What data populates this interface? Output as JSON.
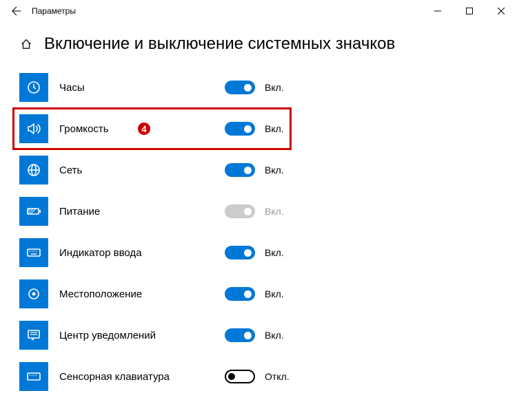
{
  "window": {
    "title": "Параметры"
  },
  "page": {
    "title": "Включение и выключение системных значков"
  },
  "items": [
    {
      "label": "Часы",
      "state": "Вкл.",
      "on": true,
      "disabled": false,
      "icon": "clock"
    },
    {
      "label": "Громкость",
      "state": "Вкл.",
      "on": true,
      "disabled": false,
      "icon": "volume"
    },
    {
      "label": "Сеть",
      "state": "Вкл.",
      "on": true,
      "disabled": false,
      "icon": "globe"
    },
    {
      "label": "Питание",
      "state": "Вкл.",
      "on": true,
      "disabled": true,
      "icon": "battery"
    },
    {
      "label": "Индикатор ввода",
      "state": "Вкл.",
      "on": true,
      "disabled": false,
      "icon": "keyboard"
    },
    {
      "label": "Местоположение",
      "state": "Вкл.",
      "on": true,
      "disabled": false,
      "icon": "location"
    },
    {
      "label": "Центр уведомлений",
      "state": "Вкл.",
      "on": true,
      "disabled": false,
      "icon": "notifications"
    },
    {
      "label": "Сенсорная клавиатура",
      "state": "Откл.",
      "on": false,
      "disabled": false,
      "icon": "touchkeyboard"
    }
  ],
  "annotation": {
    "marker": "4",
    "row_index": 1
  }
}
